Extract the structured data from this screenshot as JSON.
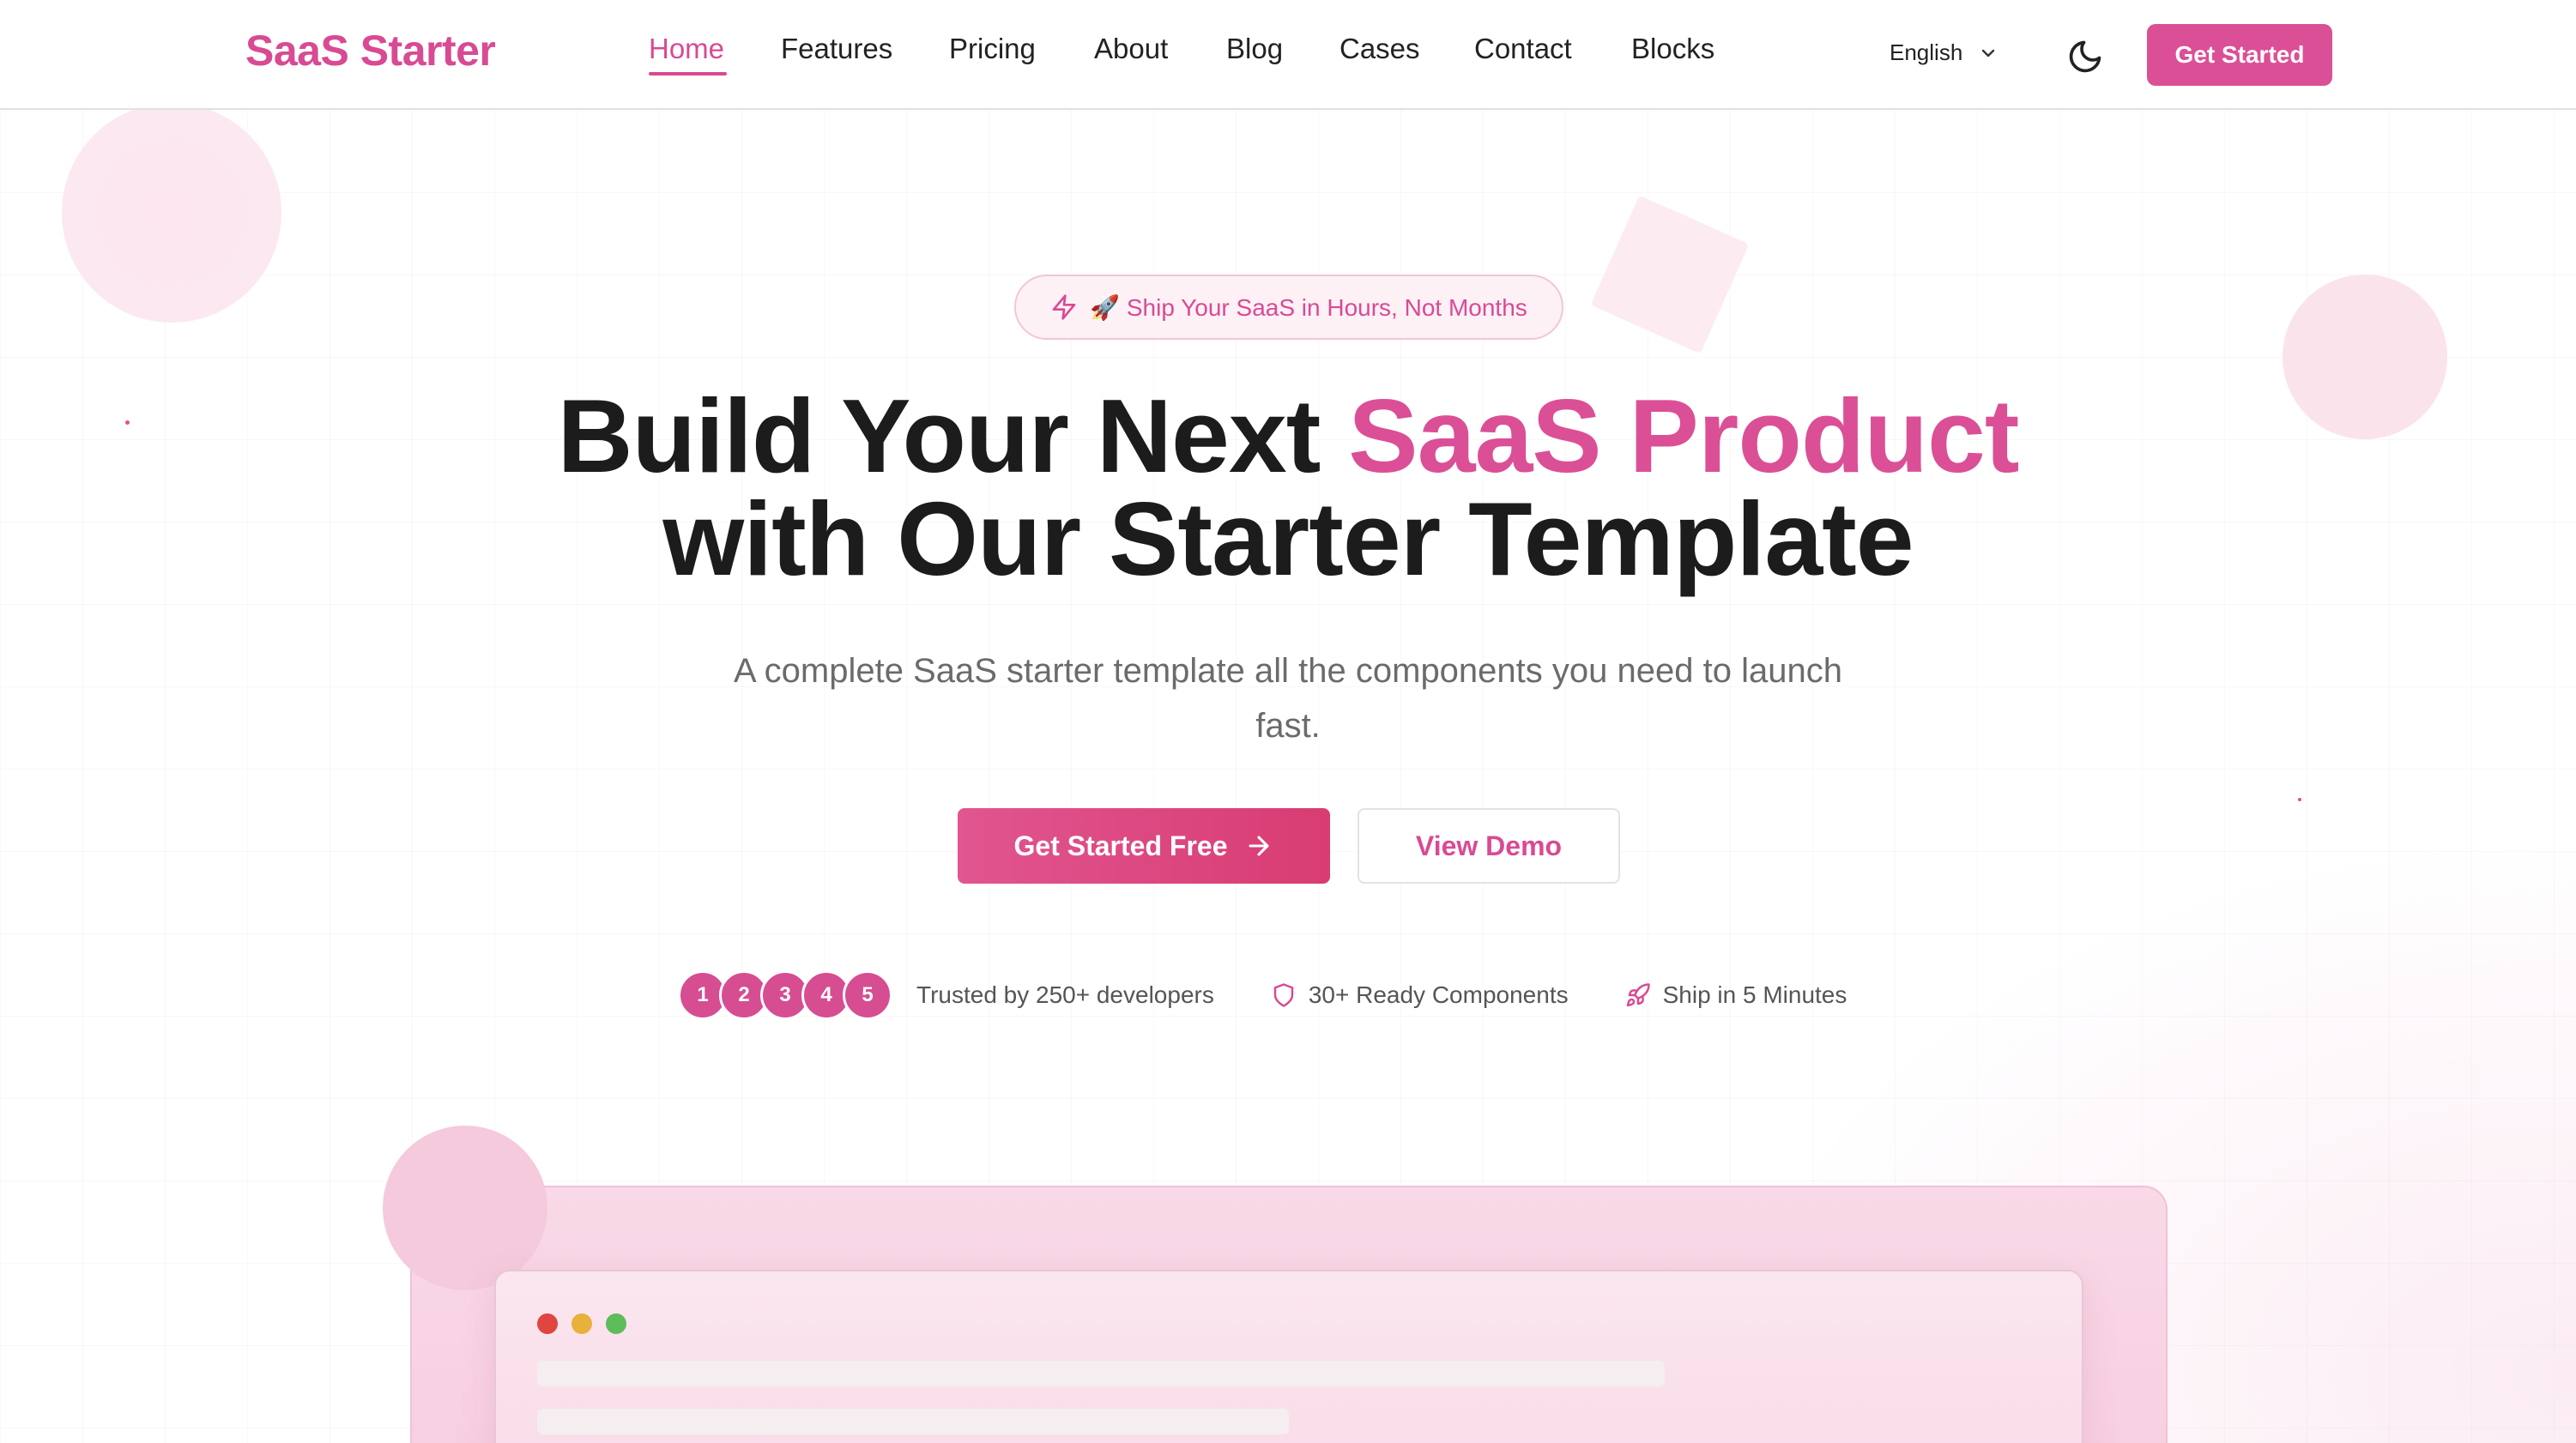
{
  "brand": {
    "name": "SaaS Starter",
    "accent": "#db4f96"
  },
  "nav": {
    "items": [
      {
        "label": "Home",
        "active": true
      },
      {
        "label": "Features"
      },
      {
        "label": "Pricing"
      },
      {
        "label": "About"
      },
      {
        "label": "Blog"
      },
      {
        "label": "Cases"
      },
      {
        "label": "Contact"
      },
      {
        "label": "Blocks"
      }
    ]
  },
  "header": {
    "language": "English",
    "language_icon": "chevron-down-icon",
    "theme_icon": "moon-icon",
    "cta_label": "Get Started"
  },
  "hero": {
    "badge_icon": "lightning-icon",
    "badge_text": "🚀 Ship Your SaaS in Hours, Not Months",
    "headline_part1": "Build Your Next ",
    "headline_accent": "SaaS Product",
    "headline_part2": "with Our Starter Template",
    "subtext": "A complete SaaS starter template all the components you need to launch fast.",
    "primary_button": "Get Started Free",
    "secondary_button": "View Demo"
  },
  "trust": {
    "avatars": [
      "1",
      "2",
      "3",
      "4",
      "5"
    ],
    "developers": "Trusted by 250+ developers",
    "components": "30+ Ready Components",
    "ship": "Ship in 5 Minutes"
  },
  "preview": {
    "window_dot_colors": [
      "#e0453f",
      "#e8b13c",
      "#5cbd5a"
    ]
  }
}
